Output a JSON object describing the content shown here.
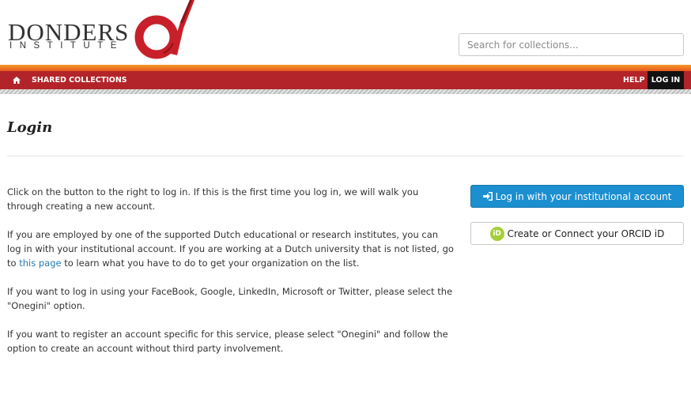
{
  "header": {
    "logo_word": "DONDERS",
    "logo_sub": "INSTITUTE",
    "search_placeholder": "Search for collections..."
  },
  "nav": {
    "home_icon": "home-icon",
    "shared_collections": "SHARED COLLECTIONS",
    "help": "HELP",
    "login": "LOG IN"
  },
  "main": {
    "title": "Login",
    "para1": "Click on the button to the right to log in. If this is the first time you log in, we will walk you through creating a new account.",
    "para2_before": "If you are employed by one of the supported Dutch educational or research institutes, you can log in with your institutional account. If you are working at a Dutch university that is not listed, go to ",
    "para2_link": "this page",
    "para2_after": " to learn what you have to do to get your organization on the list.",
    "para3": "If you want to log in using your FaceBook, Google, LinkedIn, Microsoft or Twitter, please select the \"Onegini\" option.",
    "para4": "If you want to register an account specific for this service, please select \"Onegini\" and follow the option to create an account without third party involvement."
  },
  "buttons": {
    "institutional_label": "Log in with your institutional account",
    "institutional_icon": "sign-in-icon",
    "orcid_label": "Create or Connect your ORCID iD",
    "orcid_badge": "iD"
  },
  "colors": {
    "brand_red": "#b3242a",
    "accent_orange": "#f39a2a",
    "button_blue": "#1b8fcf",
    "orcid_green": "#a6ce39",
    "link_blue": "#2a7ab0"
  }
}
